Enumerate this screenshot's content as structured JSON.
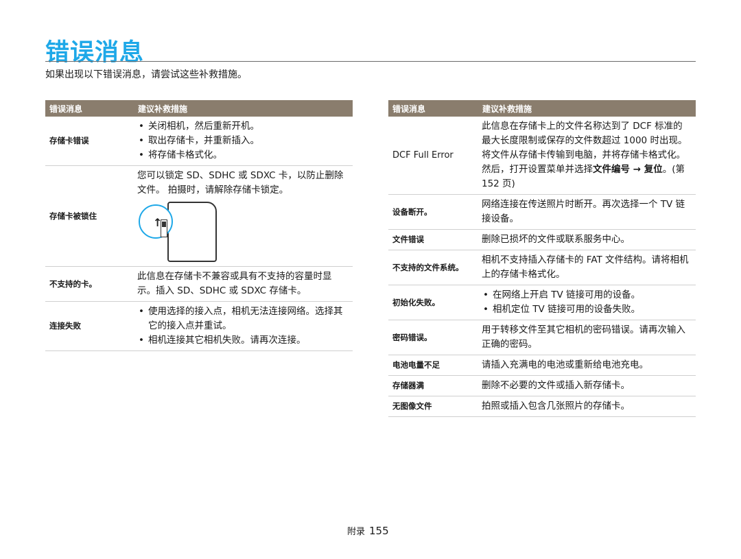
{
  "page": {
    "title": "错误消息",
    "intro": "如果出现以下错误消息，请尝试这些补救措施。",
    "footer_label": "附录",
    "page_number": "155"
  },
  "left_table": {
    "headers": [
      "错误消息",
      "建议补救措施"
    ],
    "rows": [
      {
        "name": "存储卡错误",
        "bullets": [
          "关闭相机，然后重新开机。",
          "取出存储卡，并重新插入。",
          "将存储卡格式化。"
        ]
      },
      {
        "name": "存储卡被锁住",
        "text": "您可以锁定 SD、SDHC 或 SDXC 卡，以防止删除文件。 拍摄时，请解除存储卡锁定。"
      },
      {
        "name": "不支持的卡。",
        "text": "此信息在存储卡不兼容或具有不支持的容量时显示。插入 SD、SDHC 或 SDXC 存储卡。"
      },
      {
        "name": "连接失败",
        "bullets": [
          "使用选择的接入点，相机无法连接网络。选择其它的接入点并重试。",
          "相机连接其它相机失败。请再次连接。"
        ]
      }
    ]
  },
  "right_table": {
    "headers": [
      "错误消息",
      "建议补救措施"
    ],
    "rows": [
      {
        "name": "DCF Full Error",
        "text": "此信息在存储卡上的文件名称达到了 DCF 标准的最大长度限制或保存的文件数超过 1000 时出现。将文件从存储卡传输到电脑，并将存储卡格式化。然后，打开设置菜单并选择",
        "text_bold": "文件编号 → 复位",
        "text_after": "。(第 152 页)"
      },
      {
        "name": "设备断开。",
        "text": "网络连接在传送照片时断开。再次选择一个 TV 链接设备。"
      },
      {
        "name": "文件错误",
        "text": "删除已损坏的文件或联系服务中心。"
      },
      {
        "name": "不支持的文件系统。",
        "text": "相机不支持插入存储卡的 FAT 文件结构。请将相机上的存储卡格式化。"
      },
      {
        "name": "初始化失败。",
        "bullets": [
          "在网络上开启 TV 链接可用的设备。",
          "相机定位 TV 链接可用的设备失败。"
        ]
      },
      {
        "name": "密码错误。",
        "text": "用于转移文件至其它相机的密码错误。请再次输入正确的密码。"
      },
      {
        "name": "电池电量不足",
        "text": "请插入充满电的电池或重新给电池充电。"
      },
      {
        "name": "存储器满",
        "text": "删除不必要的文件或插入新存储卡。"
      },
      {
        "name": "无图像文件",
        "text": "拍照或插入包含几张照片的存储卡。"
      }
    ]
  },
  "colors": {
    "title": "#1ea8e8",
    "header_bg": "#8a7d6d"
  },
  "icons": [
    "sd-card-lock-icon"
  ]
}
